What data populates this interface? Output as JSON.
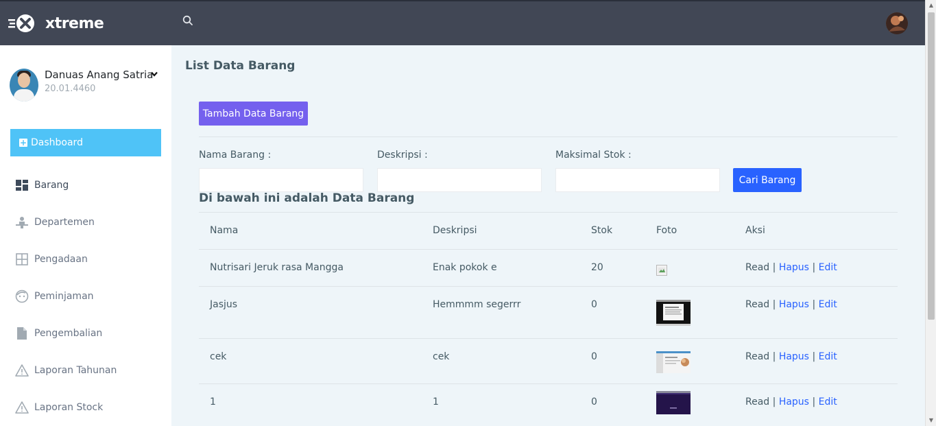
{
  "app": {
    "brand": "xtreme"
  },
  "user": {
    "name": "Danuas Anang Satria",
    "nim": "20.01.4460"
  },
  "sidebar": {
    "dashboard_label": "Dashboard",
    "items": [
      {
        "label": "Barang",
        "icon": "dashboard-grid-icon"
      },
      {
        "label": "Departemen",
        "icon": "person-desk-icon"
      },
      {
        "label": "Pengadaan",
        "icon": "grid-icon"
      },
      {
        "label": "Peminjaman",
        "icon": "face-icon"
      },
      {
        "label": "Pengembalian",
        "icon": "file-icon"
      },
      {
        "label": "Laporan Tahunan",
        "icon": "warning-icon"
      },
      {
        "label": "Laporan Stock",
        "icon": "warning-icon"
      }
    ]
  },
  "page": {
    "title": "List Data Barang",
    "add_button": "Tambah Data Barang",
    "filters": {
      "nama_label": "Nama Barang :",
      "deskripsi_label": "Deskripsi :",
      "stok_label": "Maksimal Stok :",
      "nama_value": "",
      "deskripsi_value": "",
      "stok_value": "",
      "submit": "Cari Barang"
    },
    "section_title": "Di bawah ini adalah Data Barang"
  },
  "table": {
    "headers": [
      "Nama",
      "Deskripsi",
      "Stok",
      "Foto",
      "Aksi"
    ],
    "rows": [
      {
        "nama": "Nutrisari Jeruk rasa Mangga",
        "deskripsi": "Enak pokok e",
        "stok": "20",
        "foto": "broken"
      },
      {
        "nama": "Jasjus",
        "deskripsi": "Hemmmm segerrr",
        "stok": "0",
        "foto": "dark-screenshot"
      },
      {
        "nama": "cek",
        "deskripsi": "cek",
        "stok": "0",
        "foto": "light-screenshot"
      },
      {
        "nama": "1",
        "deskripsi": "1",
        "stok": "0",
        "foto": "purple-screenshot"
      }
    ],
    "actions": {
      "read": "Read",
      "hapus": "Hapus",
      "edit": "Edit",
      "separator": "|"
    }
  },
  "colors": {
    "topbar": "#414755",
    "sidebar_active": "#4fc3f7",
    "add_button": "#7460ee",
    "search_button": "#2962ff",
    "link": "#2962ff",
    "content_bg": "#eef5f9"
  }
}
